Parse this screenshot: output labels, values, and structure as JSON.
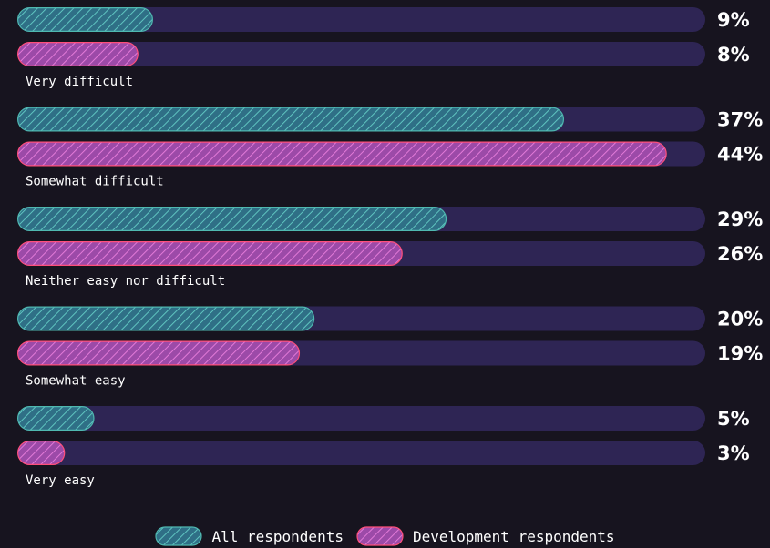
{
  "chart_data": {
    "type": "bar",
    "orientation": "horizontal",
    "categories": [
      "Very difficult",
      "Somewhat difficult",
      "Neither easy nor difficult",
      "Somewhat easy",
      "Very easy"
    ],
    "series": [
      {
        "name": "All respondents",
        "values": [
          9,
          37,
          29,
          20,
          5
        ],
        "labels": [
          "9%",
          "37%",
          "29%",
          "20%",
          "5%"
        ]
      },
      {
        "name": "Development respondents",
        "values": [
          8,
          44,
          26,
          19,
          3
        ],
        "labels": [
          "8%",
          "44%",
          "26%",
          "19%",
          "3%"
        ]
      }
    ],
    "xlim": [
      0,
      46
    ],
    "grid": false,
    "legend_position": "bottom-center"
  },
  "colors": {
    "background": "#17141f",
    "track": "#2e2554",
    "all_respondents": "#4fb8b0",
    "development_respondents": "#ff4f7a",
    "development_fill": "#c060c8",
    "all_fill": "#3d7f9a"
  }
}
